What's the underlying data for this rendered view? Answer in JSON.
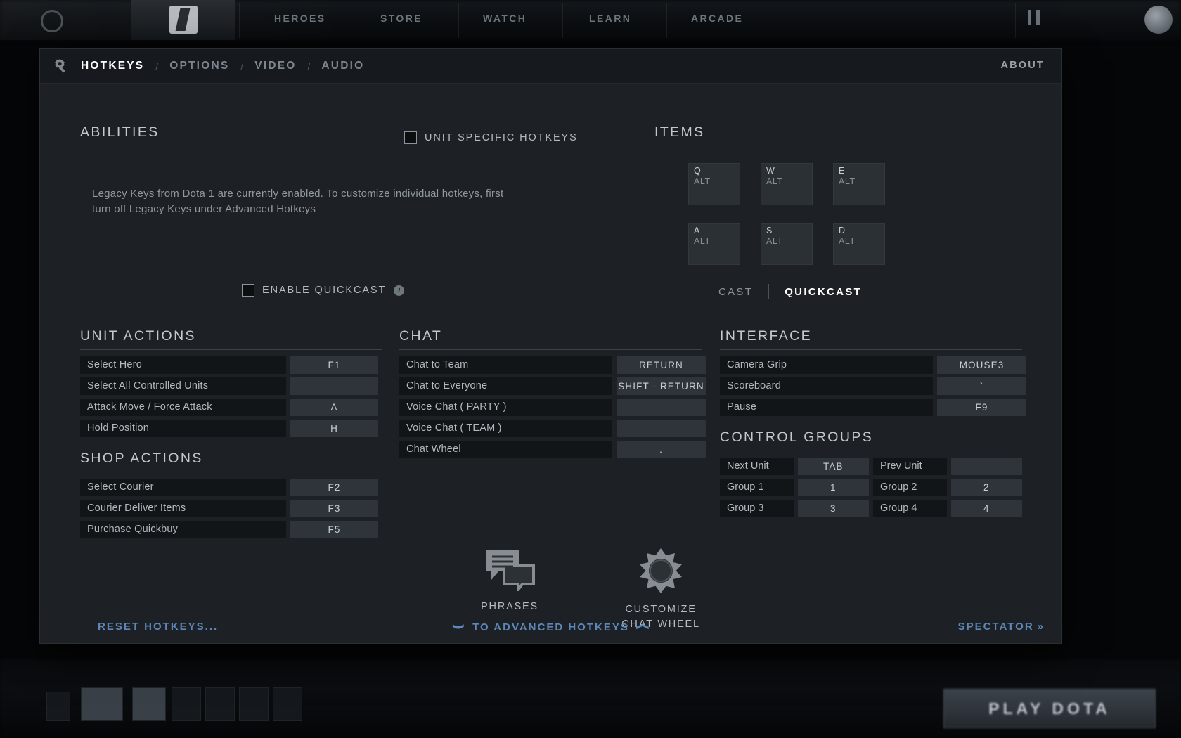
{
  "background": {
    "nav_items": [
      "HEROES",
      "STORE",
      "WATCH",
      "LEARN",
      "ARCADE"
    ],
    "play_button": "PLAY DOTA"
  },
  "header": {
    "gear_icon": "gear-icon",
    "tabs": [
      {
        "label": "HOTKEYS",
        "active": true
      },
      {
        "label": "OPTIONS",
        "active": false
      },
      {
        "label": "VIDEO",
        "active": false
      },
      {
        "label": "AUDIO",
        "active": false
      }
    ],
    "separator": "/",
    "about_label": "ABOUT"
  },
  "abilities": {
    "title": "ABILITIES",
    "legacy_note": "Legacy Keys from Dota 1 are currently enabled. To customize individual hotkeys, first turn off Legacy Keys under Advanced Hotkeys",
    "unit_specific": {
      "label": "UNIT SPECIFIC HOTKEYS",
      "checked": false
    },
    "quickcast": {
      "label": "ENABLE QUICKCAST",
      "checked": false,
      "info_icon": "info-icon"
    }
  },
  "items": {
    "title": "ITEMS",
    "boxes": [
      {
        "key": "Q",
        "modifier": "ALT"
      },
      {
        "key": "W",
        "modifier": "ALT"
      },
      {
        "key": "E",
        "modifier": "ALT"
      },
      {
        "key": "A",
        "modifier": "ALT"
      },
      {
        "key": "S",
        "modifier": "ALT"
      },
      {
        "key": "D",
        "modifier": "ALT"
      }
    ],
    "cast_toggle": {
      "cast_label": "CAST",
      "quickcast_label": "QUICKCAST",
      "selected": "QUICKCAST"
    }
  },
  "unit_actions": {
    "title": "UNIT ACTIONS",
    "rows": [
      {
        "name": "Select Hero",
        "key": "F1"
      },
      {
        "name": "Select All Controlled Units",
        "key": ""
      },
      {
        "name": "Attack Move / Force Attack",
        "key": "A"
      },
      {
        "name": "Hold Position",
        "key": "H"
      }
    ]
  },
  "shop_actions": {
    "title": "SHOP ACTIONS",
    "rows": [
      {
        "name": "Select Courier",
        "key": "F2"
      },
      {
        "name": "Courier Deliver Items",
        "key": "F3"
      },
      {
        "name": "Purchase Quickbuy",
        "key": "F5"
      }
    ]
  },
  "chat": {
    "title": "CHAT",
    "rows": [
      {
        "name": "Chat to Team",
        "key": "RETURN"
      },
      {
        "name": "Chat to Everyone",
        "key": "SHIFT - RETURN"
      },
      {
        "name": "Voice Chat ( PARTY )",
        "key": ""
      },
      {
        "name": "Voice Chat ( TEAM )",
        "key": ""
      },
      {
        "name": "Chat Wheel",
        "key": "."
      }
    ],
    "phrases": {
      "icon": "speech-bubbles-icon",
      "label": "PHRASES"
    },
    "chat_wheel": {
      "icon": "chat-wheel-icon",
      "label_line1": "CUSTOMIZE",
      "label_line2": "CHAT WHEEL"
    }
  },
  "interface": {
    "title": "INTERFACE",
    "rows": [
      {
        "name": "Camera Grip",
        "key": "MOUSE3"
      },
      {
        "name": "Scoreboard",
        "key": "`"
      },
      {
        "name": "Pause",
        "key": "F9"
      }
    ]
  },
  "control_groups": {
    "title": "CONTROL GROUPS",
    "rows": [
      [
        {
          "name": "Next Unit",
          "key": "TAB"
        },
        {
          "name": "Prev Unit",
          "key": ""
        }
      ],
      [
        {
          "name": "Group 1",
          "key": "1"
        },
        {
          "name": "Group 2",
          "key": "2"
        }
      ],
      [
        {
          "name": "Group 3",
          "key": "3"
        },
        {
          "name": "Group 4",
          "key": "4"
        }
      ]
    ]
  },
  "footer": {
    "reset_label": "RESET HOTKEYS...",
    "advanced_label": "TO ADVANCED HOTKEYS",
    "spectator_label": "SPECTATOR",
    "spectator_arrow": "»",
    "chevron": "chevron-down-icon"
  },
  "colors": {
    "panel_bg": "#1d2125",
    "header_bg": "#16191d",
    "row_bg": "#121517",
    "key_bg": "#2f343a",
    "link_blue": "#5c87b8",
    "text_primary": "#c2c8ce",
    "text_muted": "#8b939a"
  }
}
